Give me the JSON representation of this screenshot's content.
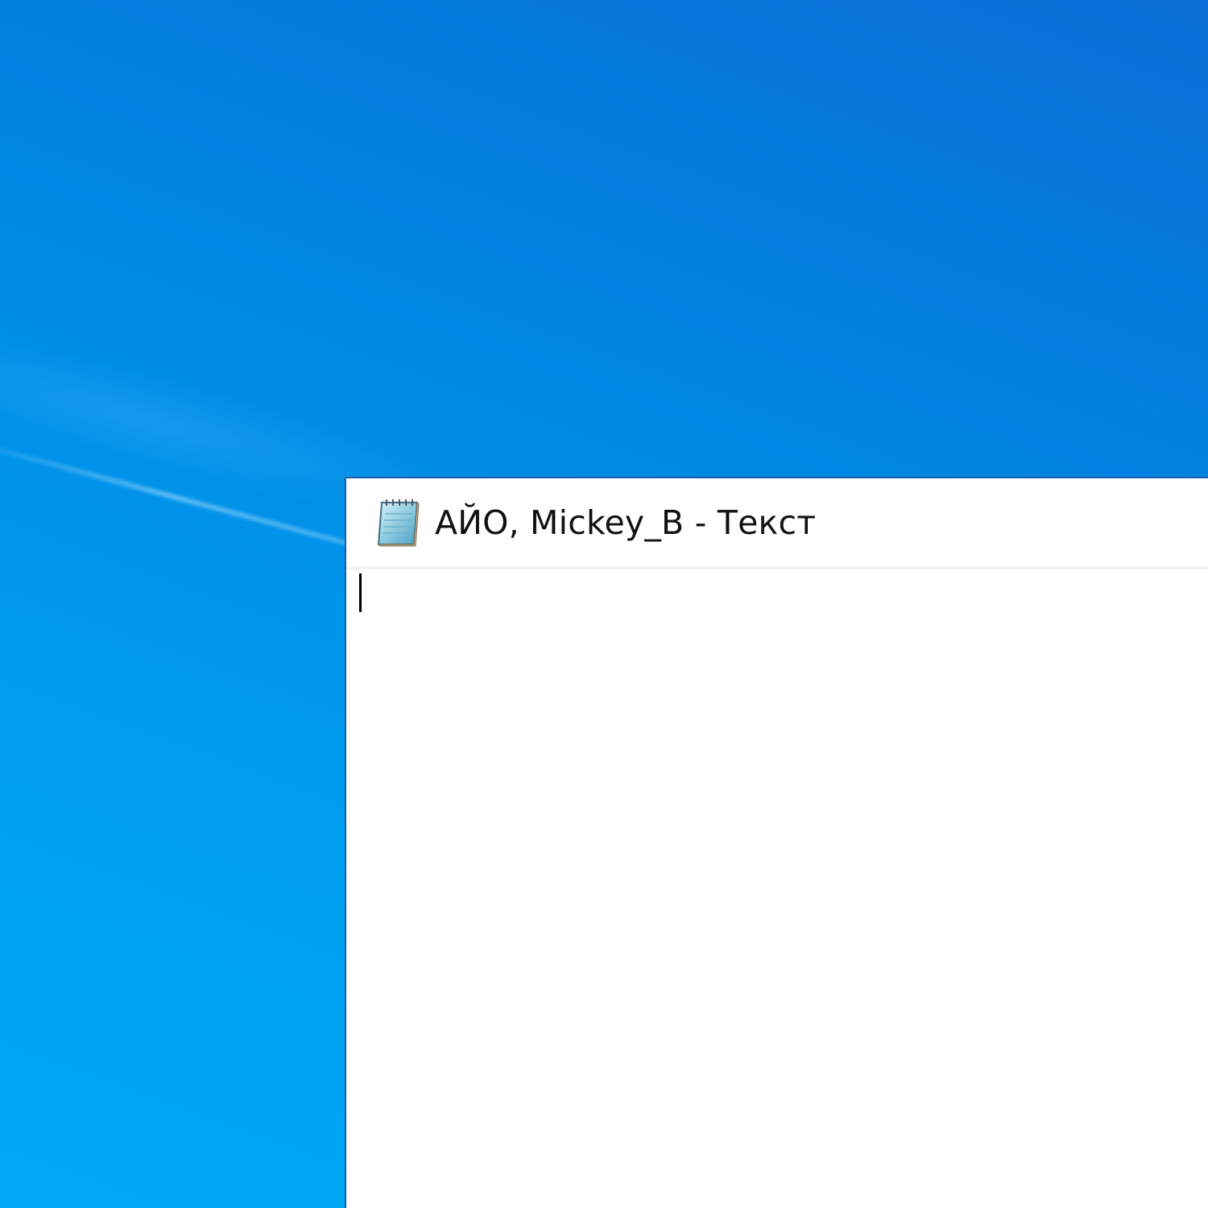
{
  "desktop": {
    "background_color": "#0085e3"
  },
  "window": {
    "title": "АЙО, Mickey_B - Текст",
    "icon": "notepad-icon",
    "editor_content": ""
  }
}
